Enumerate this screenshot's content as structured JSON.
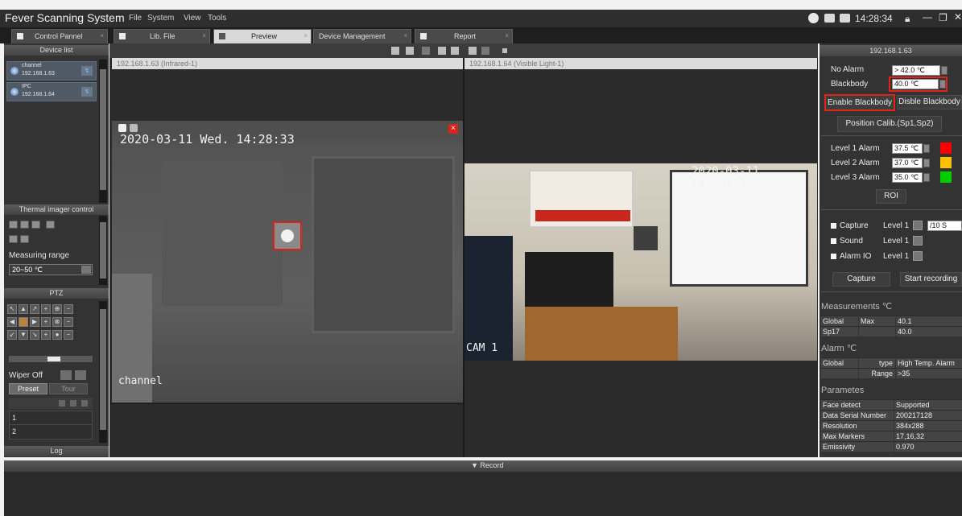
{
  "app": {
    "title": "Fever Scanning System",
    "menu": [
      "File",
      "System",
      "View",
      "Tools"
    ],
    "time": "14:28:34"
  },
  "tabs": [
    {
      "label": "Control Pannel"
    },
    {
      "label": "Lib. File"
    },
    {
      "label": "Preview"
    },
    {
      "label": "Device Management"
    },
    {
      "label": "Report"
    }
  ],
  "left": {
    "device_list_title": "Device list",
    "devices": [
      {
        "name": "channel",
        "ip": "192.168.1.63"
      },
      {
        "name": "IPC",
        "ip": "192.168.1.64"
      }
    ],
    "thermal_title": "Thermal imager control",
    "measuring_range_label": "Measuring range",
    "measuring_range_value": "20~50 ℃",
    "ptz_title": "PTZ",
    "wiper_label": "Wiper Off",
    "preset_label": "Preset",
    "tour_label": "Tour",
    "preset_rows": [
      "1",
      "2"
    ],
    "log_title": "Log"
  },
  "video": {
    "ch1_title": "192.168.1.63 (Infrared-1)",
    "ch2_title": "192.168.1.64 (Visible Light-1)",
    "ch1_osd_time": "2020-03-11 Wed. 14:28:33",
    "ch1_osd_name": "channel",
    "ch2_osd_time": "2020-03-11 14:28:33",
    "ch2_osd_name": "CAM 1"
  },
  "right": {
    "ip": "192.168.1.63",
    "no_alarm_label": "No Alarm",
    "no_alarm_value": "> 42.0 ℃",
    "blackbody_label": "Blackbody",
    "blackbody_value": "40.0 ℃",
    "enable_blackbody": "Enable Blackbody",
    "disable_blackbody": "Disble Blackbody",
    "position_calib": "Position Calib.(Sp1,Sp2)",
    "levels": [
      {
        "label": "Level 1 Alarm",
        "value": "37.5 ℃",
        "color": "#ff0000"
      },
      {
        "label": "Level 2 Alarm",
        "value": "37.0 ℃",
        "color": "#ffc000"
      },
      {
        "label": "Level 3 Alarm",
        "value": "35.0 ℃",
        "color": "#00cc00"
      }
    ],
    "roi": "ROI",
    "options": [
      {
        "label": "Capture",
        "level": "Level 1",
        "extra": "/10 S"
      },
      {
        "label": "Sound",
        "level": "Level 1"
      },
      {
        "label": "Alarm IO",
        "level": "Level 1"
      }
    ],
    "capture_button": "Capture",
    "start_recording_button": "Start recording",
    "measurements_title": "Measurements ℃",
    "measurements": [
      {
        "c1": "Global",
        "c2": "Max",
        "c3": "40.1"
      },
      {
        "c1": "Sp17",
        "c2": "",
        "c3": "40.0"
      }
    ],
    "alarm_title": "Alarm ℃",
    "alarm_rows": [
      {
        "c1": "Global",
        "c2": "type",
        "c3": "High Temp. Alarm"
      },
      {
        "c1": "",
        "c2": "Range",
        "c3": ">35"
      }
    ],
    "params_title": "Parametes",
    "params": [
      {
        "k": "Face detect",
        "v": "Supported"
      },
      {
        "k": "Data Serial Number",
        "v": "200217128"
      },
      {
        "k": "Resolution",
        "v": "384x288"
      },
      {
        "k": "Max Markers",
        "v": "17,16,32"
      },
      {
        "k": "Emissivity",
        "v": "0.970"
      }
    ]
  },
  "bottom": {
    "record_label": "▼ Record"
  }
}
